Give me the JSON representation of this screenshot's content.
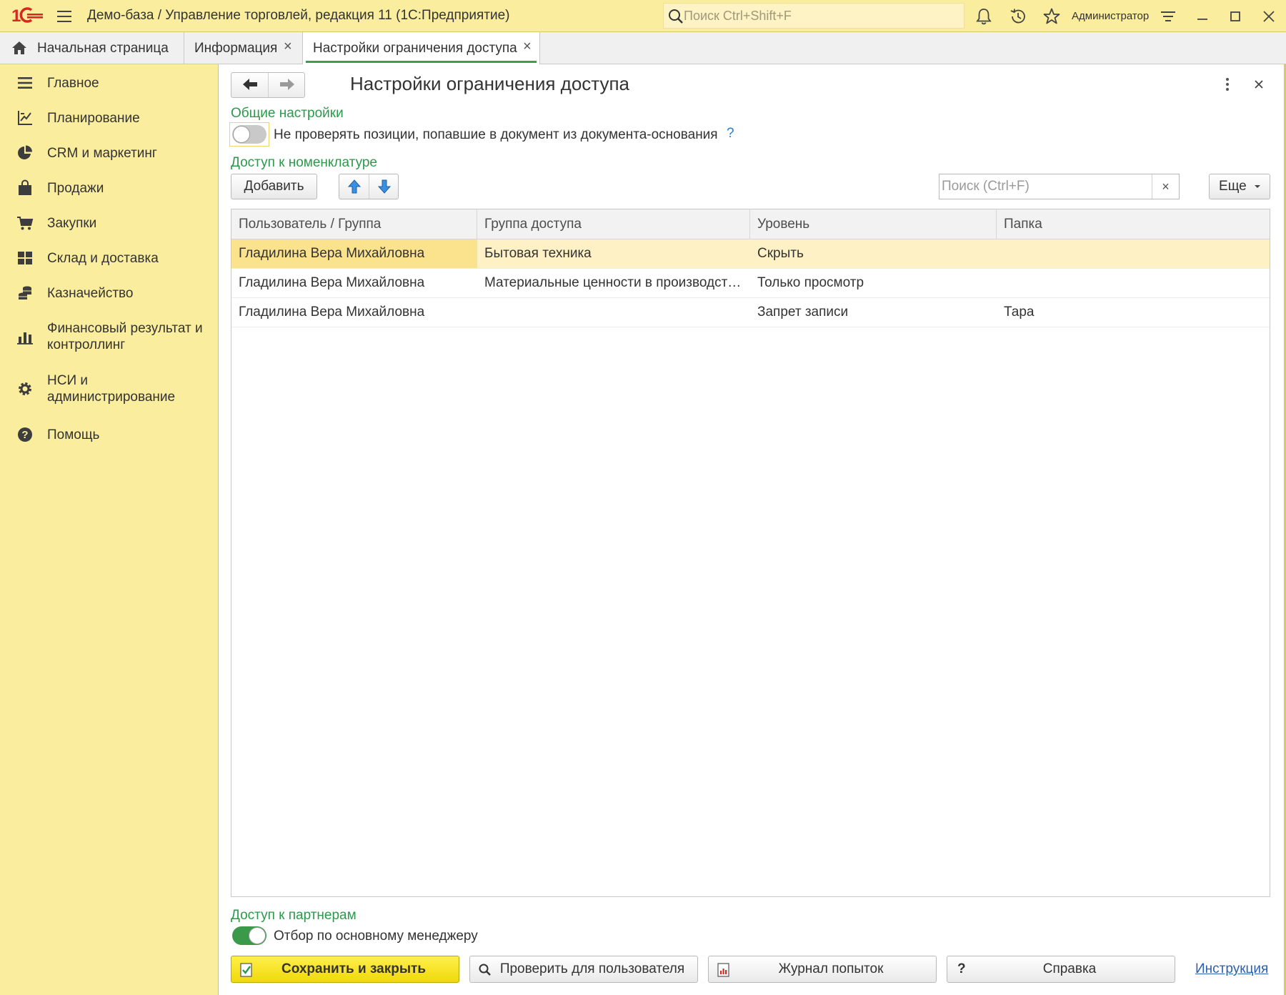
{
  "window": {
    "app_title": "Демо-база / Управление торговлей, редакция 11  (1С:Предприятие)",
    "search_placeholder": "Поиск Ctrl+Shift+F",
    "user": "Администратор",
    "logo_text": "1С"
  },
  "tabs": [
    {
      "label": "Начальная страница",
      "closable": false
    },
    {
      "label": "Информация",
      "closable": true
    },
    {
      "label": "Настройки ограничения доступа",
      "closable": true,
      "active": true
    }
  ],
  "tab_close_glyph": "×",
  "sidebar": {
    "items": [
      {
        "label": "Главное",
        "icon": "list-icon"
      },
      {
        "label": "Планирование",
        "icon": "planning-icon"
      },
      {
        "label": "CRM и маркетинг",
        "icon": "pie-chart-icon"
      },
      {
        "label": "Продажи",
        "icon": "bag-icon"
      },
      {
        "label": "Закупки",
        "icon": "cart-icon"
      },
      {
        "label": "Склад и доставка",
        "icon": "warehouse-icon"
      },
      {
        "label": "Казначейство",
        "icon": "coins-icon"
      },
      {
        "label": "Финансовый результат и контроллинг",
        "icon": "bar-chart-icon"
      },
      {
        "label": "НСИ и администрирование",
        "icon": "gear-icon"
      },
      {
        "label": "Помощь",
        "icon": "help-icon"
      }
    ]
  },
  "form": {
    "title": "Настройки ограничения доступа",
    "general_group": "Общие настройки",
    "skip_check_label": "Не проверять позиции, попавшие в документ из документа-основания",
    "skip_check_on": false,
    "help_mark": "?",
    "nomenclature_group": "Доступ к номенклатуре",
    "add_button": "Добавить",
    "list_search_placeholder": "Поиск (Ctrl+F)",
    "clear_glyph": "×",
    "more_button": "Еще",
    "columns": [
      "Пользователь / Группа",
      "Группа доступа",
      "Уровень",
      "Папка"
    ],
    "rows": [
      {
        "user": "Гладилина Вера Михайловна",
        "group": "Бытовая техника",
        "level": "Скрыть",
        "folder": "",
        "selected": true
      },
      {
        "user": "Гладилина Вера Михайловна",
        "group": "Материальные ценности в производстве",
        "level": "Только просмотр",
        "folder": ""
      },
      {
        "user": "Гладилина Вера Михайловна",
        "group": "",
        "level": "Запрет записи",
        "folder": "Тара"
      }
    ],
    "partners_group": "Доступ к партнерам",
    "manager_filter_label": "Отбор по основному менеджеру",
    "manager_filter_on": true
  },
  "footer": {
    "save_close": "Сохранить и закрыть",
    "check_user": "Проверить для пользователя",
    "attempts_log": "Журнал попыток",
    "help_glyph": "?",
    "help": "Справка",
    "instruction": "Инструкция"
  },
  "colors": {
    "accent_green": "#2a9a4a",
    "panel_yellow": "#fbed9e",
    "primary_button": "#f5e11a",
    "selection": "#fdf1c5",
    "logo_red": "#d22b20"
  }
}
